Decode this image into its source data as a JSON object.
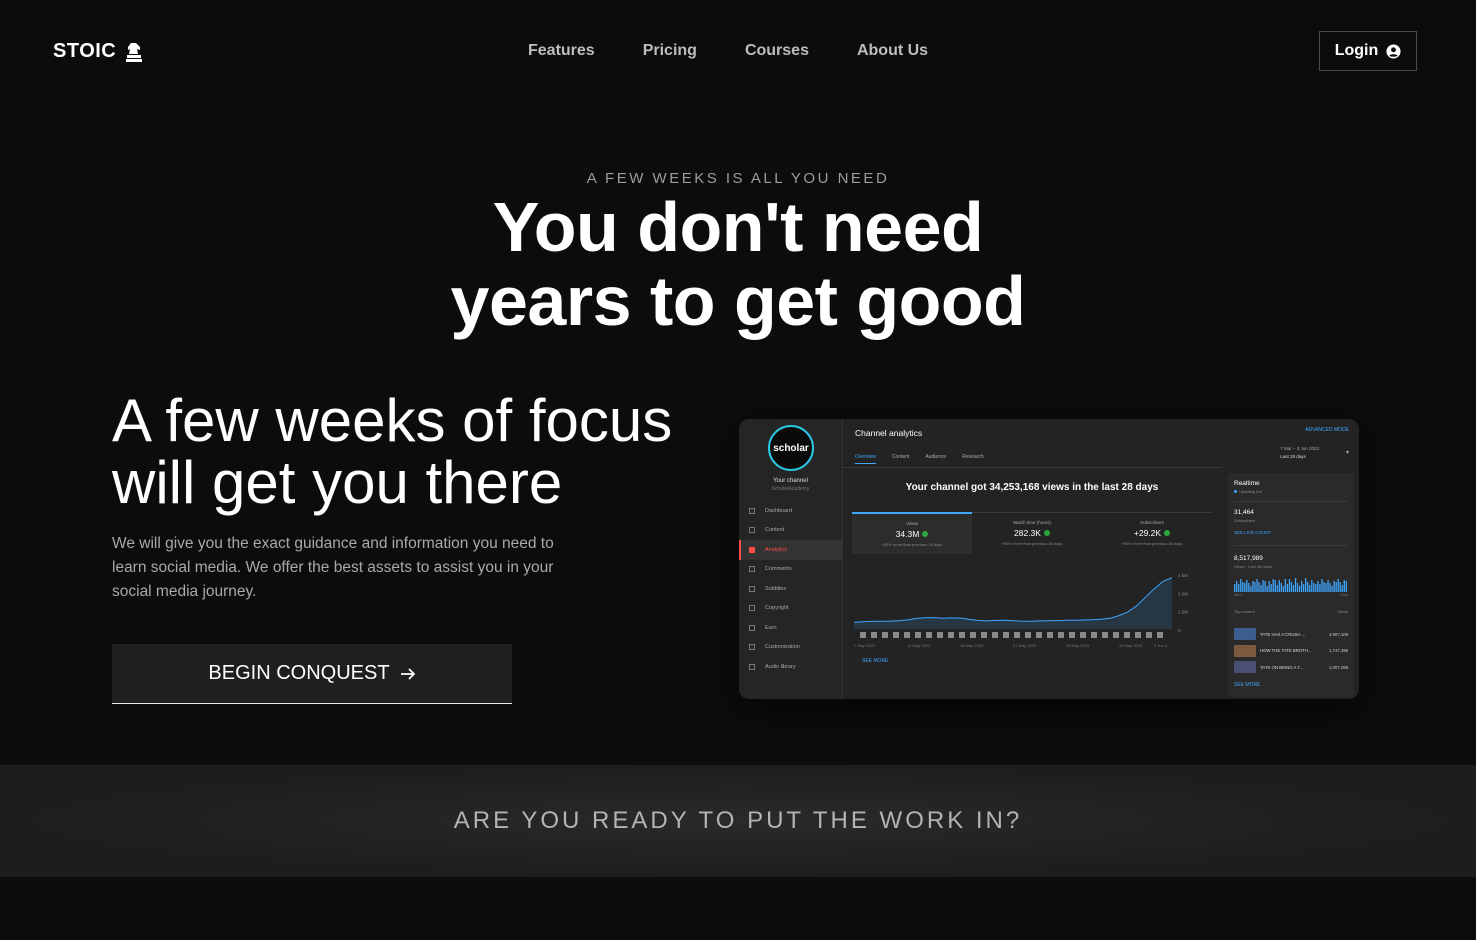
{
  "nav": {
    "brand": "STOIC",
    "links": [
      "Features",
      "Pricing",
      "Courses",
      "About Us"
    ],
    "login": "Login"
  },
  "hero": {
    "eyebrow": "A FEW WEEKS IS ALL YOU NEED",
    "headline_line1": "You don't need",
    "headline_line2": "years to get good",
    "subhead_line1": "A few weeks of focus",
    "subhead_line2": "will get you there",
    "copy": "We will give you the exact guidance and information you need to learn social media. We offer the best assets to assist you in your social media journey.",
    "cta": "BEGIN CONQUEST"
  },
  "dashboard": {
    "avatar_text": "scholar",
    "your_channel": "Your channel",
    "channel_handle": "ScholarAcademy",
    "side_items": [
      "Dashboard",
      "Content",
      "Analytics",
      "Comments",
      "Subtitles",
      "Copyright",
      "Earn",
      "Customization",
      "Audio library"
    ],
    "active_item": "Analytics",
    "title": "Channel analytics",
    "advanced": "ADVANCED MODE",
    "date_line1": "7 Mar – 3 Jun 2023",
    "date_line2": "Last 28 days",
    "tabs": [
      "Overview",
      "Content",
      "Audience",
      "Research"
    ],
    "summary": "Your channel got 34,253,168 views in the last 28 days",
    "stats": [
      {
        "label": "Views",
        "value": "34.3M",
        "note": "+93% more than previous 28 days"
      },
      {
        "label": "Watch time (hours)",
        "value": "282.3K",
        "note": "+93% more than previous 28 days"
      },
      {
        "label": "Subscribers",
        "value": "+29.2K",
        "note": "+93% more than previous 28 days"
      }
    ],
    "y_ticks": [
      "4.5M",
      "3.0M",
      "1.5M",
      "0"
    ],
    "x_ticks": [
      "7 May 2023",
      "12 May 2023",
      "16 May 2023",
      "21 May 2023",
      "25 May 2023",
      "30 May 2023",
      "3 Jun 2..."
    ],
    "see_more": "SEE MORE",
    "realtime": {
      "title": "Realtime",
      "live": "Updating live",
      "subs": "31,464",
      "subs_label": "Subscribers",
      "live_count": "SEE LIVE COUNT",
      "views": "8,517,989",
      "views_label": "Views · Last 48 hours",
      "axis_left": "48 h",
      "axis_right": "Now",
      "head_left": "Top content",
      "head_right": "Views",
      "rows": [
        {
          "name": "TATE HAS A CRUSH ...",
          "value": "4,907,109",
          "thumb": "#3b5d8f"
        },
        {
          "name": "HOW THE TATE BROTH...",
          "value": "1,747,496",
          "thumb": "#7d5a3e"
        },
        {
          "name": "TATE ON BEING A T...",
          "value": "1,007,288",
          "thumb": "#4a4f73"
        }
      ],
      "see_more": "SEE MORE"
    },
    "chart_data": {
      "type": "line",
      "values": [
        0.55,
        0.6,
        0.62,
        0.64,
        0.65,
        0.68,
        0.74,
        0.86,
        0.92,
        0.93,
        0.88,
        0.91,
        0.89,
        0.8,
        0.7,
        0.66,
        0.7,
        0.72,
        0.68,
        0.65,
        0.64,
        0.66,
        0.67,
        0.69,
        0.71,
        0.72,
        0.74,
        0.76,
        0.8,
        0.88,
        1.1,
        1.4,
        1.9,
        2.6,
        3.3,
        3.9,
        4.2
      ],
      "ylim": [
        0,
        4.5
      ],
      "color": "#3ea6ff"
    }
  },
  "band": {
    "text": "ARE YOU READY TO PUT THE WORK IN?"
  }
}
